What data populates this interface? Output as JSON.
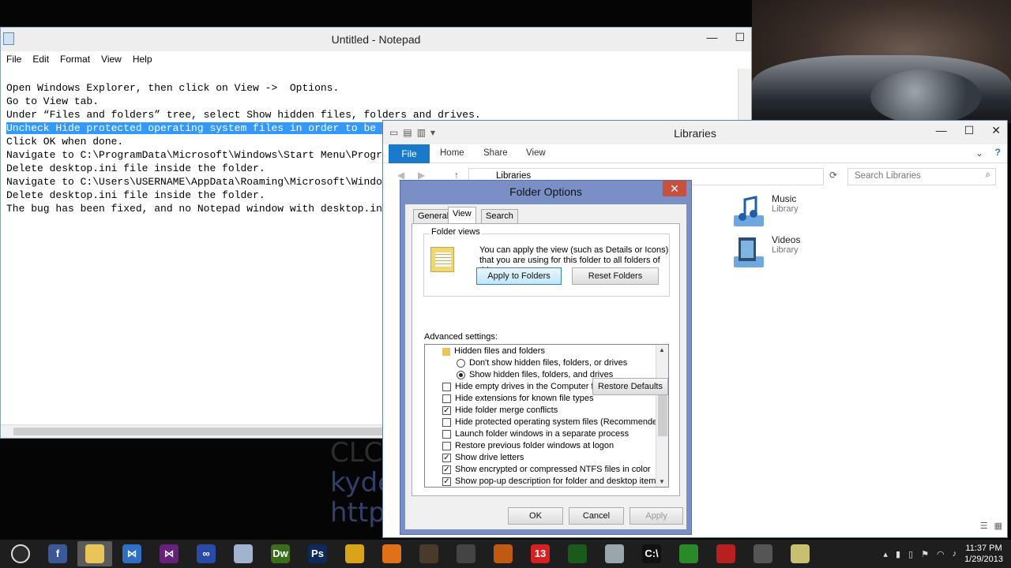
{
  "notepad": {
    "title": "Untitled - Notepad",
    "menu": [
      "File",
      "Edit",
      "Format",
      "View",
      "Help"
    ],
    "lines": [
      "Open Windows Explorer, then click on View ->  Options.",
      "Go to View tab.",
      "Under “Files and folders” tree, select Show hidden files, folders and drives.",
      "Uncheck Hide protected operating system files in order to be abl",
      "Click OK when done.",
      "Navigate to C:\\ProgramData\\Microsoft\\Windows\\Start Menu\\Programs",
      "Delete desktop.ini file inside the folder.",
      "Navigate to C:\\Users\\USERNAME\\AppData\\Roaming\\Microsoft\\Windows\\",
      "Delete desktop.ini file inside the folder.",
      "The bug has been fixed, and no Notepad window with desktop.ini w"
    ]
  },
  "watermark": {
    "line1": "CLC",
    "line2": "kyde",
    "line3": "http"
  },
  "explorer": {
    "title": "Libraries",
    "tabs": {
      "file": "File",
      "home": "Home",
      "share": "Share",
      "view": "View"
    },
    "path": "Libraries",
    "search_placeholder": "Search Libraries",
    "items": [
      {
        "name": "Music",
        "type": "Library"
      },
      {
        "name": "Videos",
        "type": "Library"
      }
    ]
  },
  "dialog": {
    "title": "Folder Options",
    "tabs": {
      "general": "General",
      "view": "View",
      "search": "Search"
    },
    "folder_views_label": "Folder views",
    "folder_views_text": "You can apply the view (such as Details or Icons) that you are using for this folder to all folders of this type.",
    "apply_folders": "Apply to Folders",
    "reset_folders": "Reset Folders",
    "advanced_label": "Advanced settings:",
    "advanced": [
      {
        "kind": "folder",
        "label": "Hidden files and folders"
      },
      {
        "kind": "radio",
        "checked": false,
        "label": "Don't show hidden files, folders, or drives"
      },
      {
        "kind": "radio",
        "checked": true,
        "label": "Show hidden files, folders, and drives"
      },
      {
        "kind": "check",
        "checked": false,
        "label": "Hide empty drives in the Computer folder"
      },
      {
        "kind": "check",
        "checked": false,
        "label": "Hide extensions for known file types"
      },
      {
        "kind": "check",
        "checked": true,
        "label": "Hide folder merge conflicts"
      },
      {
        "kind": "check",
        "checked": false,
        "label": "Hide protected operating system files (Recommended)"
      },
      {
        "kind": "check",
        "checked": false,
        "label": "Launch folder windows in a separate process"
      },
      {
        "kind": "check",
        "checked": false,
        "label": "Restore previous folder windows at logon"
      },
      {
        "kind": "check",
        "checked": true,
        "label": "Show drive letters"
      },
      {
        "kind": "check",
        "checked": true,
        "label": "Show encrypted or compressed NTFS files in color"
      },
      {
        "kind": "check",
        "checked": true,
        "label": "Show pop-up description for folder and desktop items"
      }
    ],
    "restore_defaults": "Restore Defaults",
    "ok": "OK",
    "cancel": "Cancel",
    "apply": "Apply"
  },
  "taskbar": {
    "apps": [
      {
        "name": "start-icon",
        "label": "",
        "color": "#2b2b2b"
      },
      {
        "name": "facebook-icon",
        "label": "f",
        "color": "#3b5998"
      },
      {
        "name": "file-explorer-icon",
        "label": "",
        "color": "#e8c45a"
      },
      {
        "name": "visual-studio-icon",
        "label": "⋈",
        "color": "#2f6fc4"
      },
      {
        "name": "visual-studio-purple-icon",
        "label": "⋈",
        "color": "#68217a"
      },
      {
        "name": "infinity-icon",
        "label": "∞",
        "color": "#2a4aa8"
      },
      {
        "name": "cube-icon",
        "label": "",
        "color": "#a0b4d0"
      },
      {
        "name": "dreamweaver-icon",
        "label": "Dw",
        "color": "#3a6e1a"
      },
      {
        "name": "photoshop-icon",
        "label": "Ps",
        "color": "#0c2a5a"
      },
      {
        "name": "chrome-icon",
        "label": "",
        "color": "#d9a41a"
      },
      {
        "name": "firefox-icon",
        "label": "",
        "color": "#e0701a"
      },
      {
        "name": "game-icon",
        "label": "",
        "color": "#4a3a2a"
      },
      {
        "name": "media-icon",
        "label": "",
        "color": "#444444"
      },
      {
        "name": "sun-icon",
        "label": "",
        "color": "#c05a10"
      },
      {
        "name": "badge-13-icon",
        "label": "13",
        "color": "#d82020"
      },
      {
        "name": "terminal-green-icon",
        "label": "",
        "color": "#1a5a1a"
      },
      {
        "name": "glass-icon",
        "label": "",
        "color": "#9aa6ae"
      },
      {
        "name": "cmd-icon",
        "label": "C:\\",
        "color": "#111111"
      },
      {
        "name": "globe-icon",
        "label": "",
        "color": "#2a8a2a"
      },
      {
        "name": "phone-icon",
        "label": "",
        "color": "#b82020"
      },
      {
        "name": "camera-icon",
        "label": "",
        "color": "#555555"
      },
      {
        "name": "chart-icon",
        "label": "",
        "color": "#c8c070"
      }
    ],
    "time": "11:37 PM",
    "date": "1/29/2013"
  },
  "colors": {
    "accent": "#1979ca",
    "selection": "#3399ff",
    "dialog_frame": "#7a8fc6"
  }
}
